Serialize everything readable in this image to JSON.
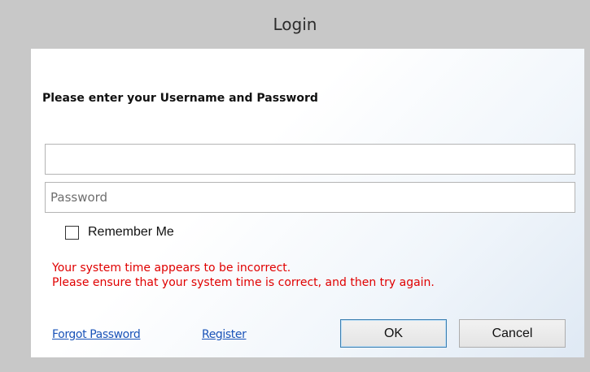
{
  "window": {
    "title": "Login"
  },
  "form": {
    "prompt": "Please enter your Username and Password",
    "username_value": "",
    "username_placeholder": "",
    "password_placeholder": "Password",
    "remember_label": "Remember Me",
    "remember_checked": false
  },
  "error": {
    "line1": "Your system time appears to be incorrect.",
    "line2": "Please ensure that your system time is correct, and then try again."
  },
  "links": {
    "forgot": "Forgot Password",
    "register": "Register"
  },
  "buttons": {
    "ok": "OK",
    "cancel": "Cancel"
  },
  "colors": {
    "error": "#e00000",
    "link": "#1a53b8",
    "titlebar": "#c8c8c8"
  }
}
